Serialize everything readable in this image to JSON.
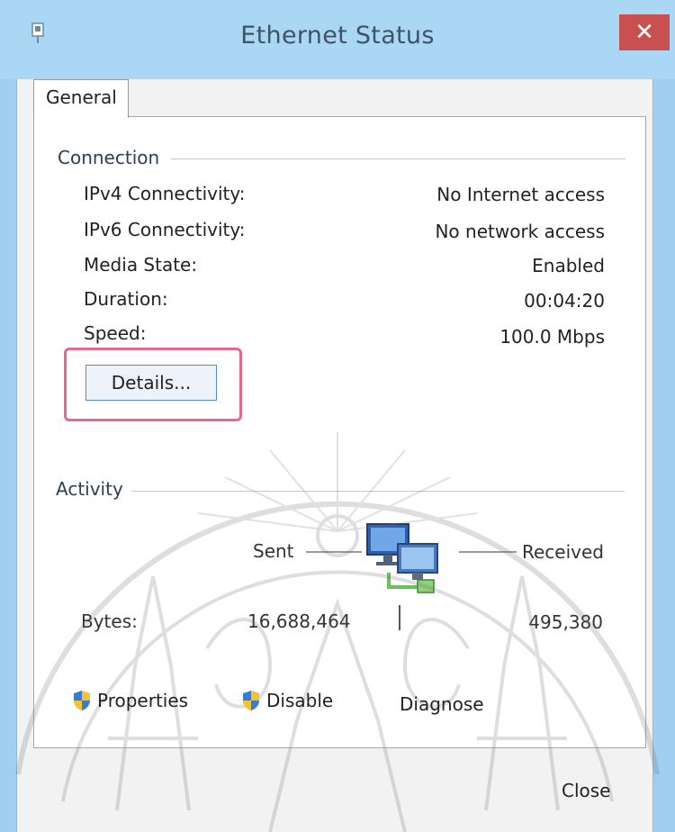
{
  "window": {
    "title": "Ethernet Status",
    "close_glyph": "✕"
  },
  "tabs": [
    {
      "label": "General",
      "selected": true
    }
  ],
  "connection": {
    "group_label": "Connection",
    "rows": [
      {
        "label": "IPv4 Connectivity:",
        "value": "No Internet access"
      },
      {
        "label": "IPv6 Connectivity:",
        "value": "No network access"
      },
      {
        "label": "Media State:",
        "value": "Enabled"
      },
      {
        "label": "Duration:",
        "value": "00:04:20"
      },
      {
        "label": "Speed:",
        "value": "100.0 Mbps"
      }
    ],
    "details_button": "Details..."
  },
  "activity": {
    "group_label": "Activity",
    "sent_label": "Sent",
    "received_label": "Received",
    "bytes_label": "Bytes:",
    "bytes_sent": "16,688,464",
    "bytes_received": "495,380",
    "network_icon": "network-computers-icon"
  },
  "buttons": {
    "properties": "Properties",
    "disable": "Disable",
    "diagnose": "Diagnose",
    "close": "Close"
  },
  "colors": {
    "title_bar": "#a9d7f4",
    "close_button": "#c8514f",
    "highlight_box": "#e46b85",
    "watermark": "#8a8a8a"
  }
}
